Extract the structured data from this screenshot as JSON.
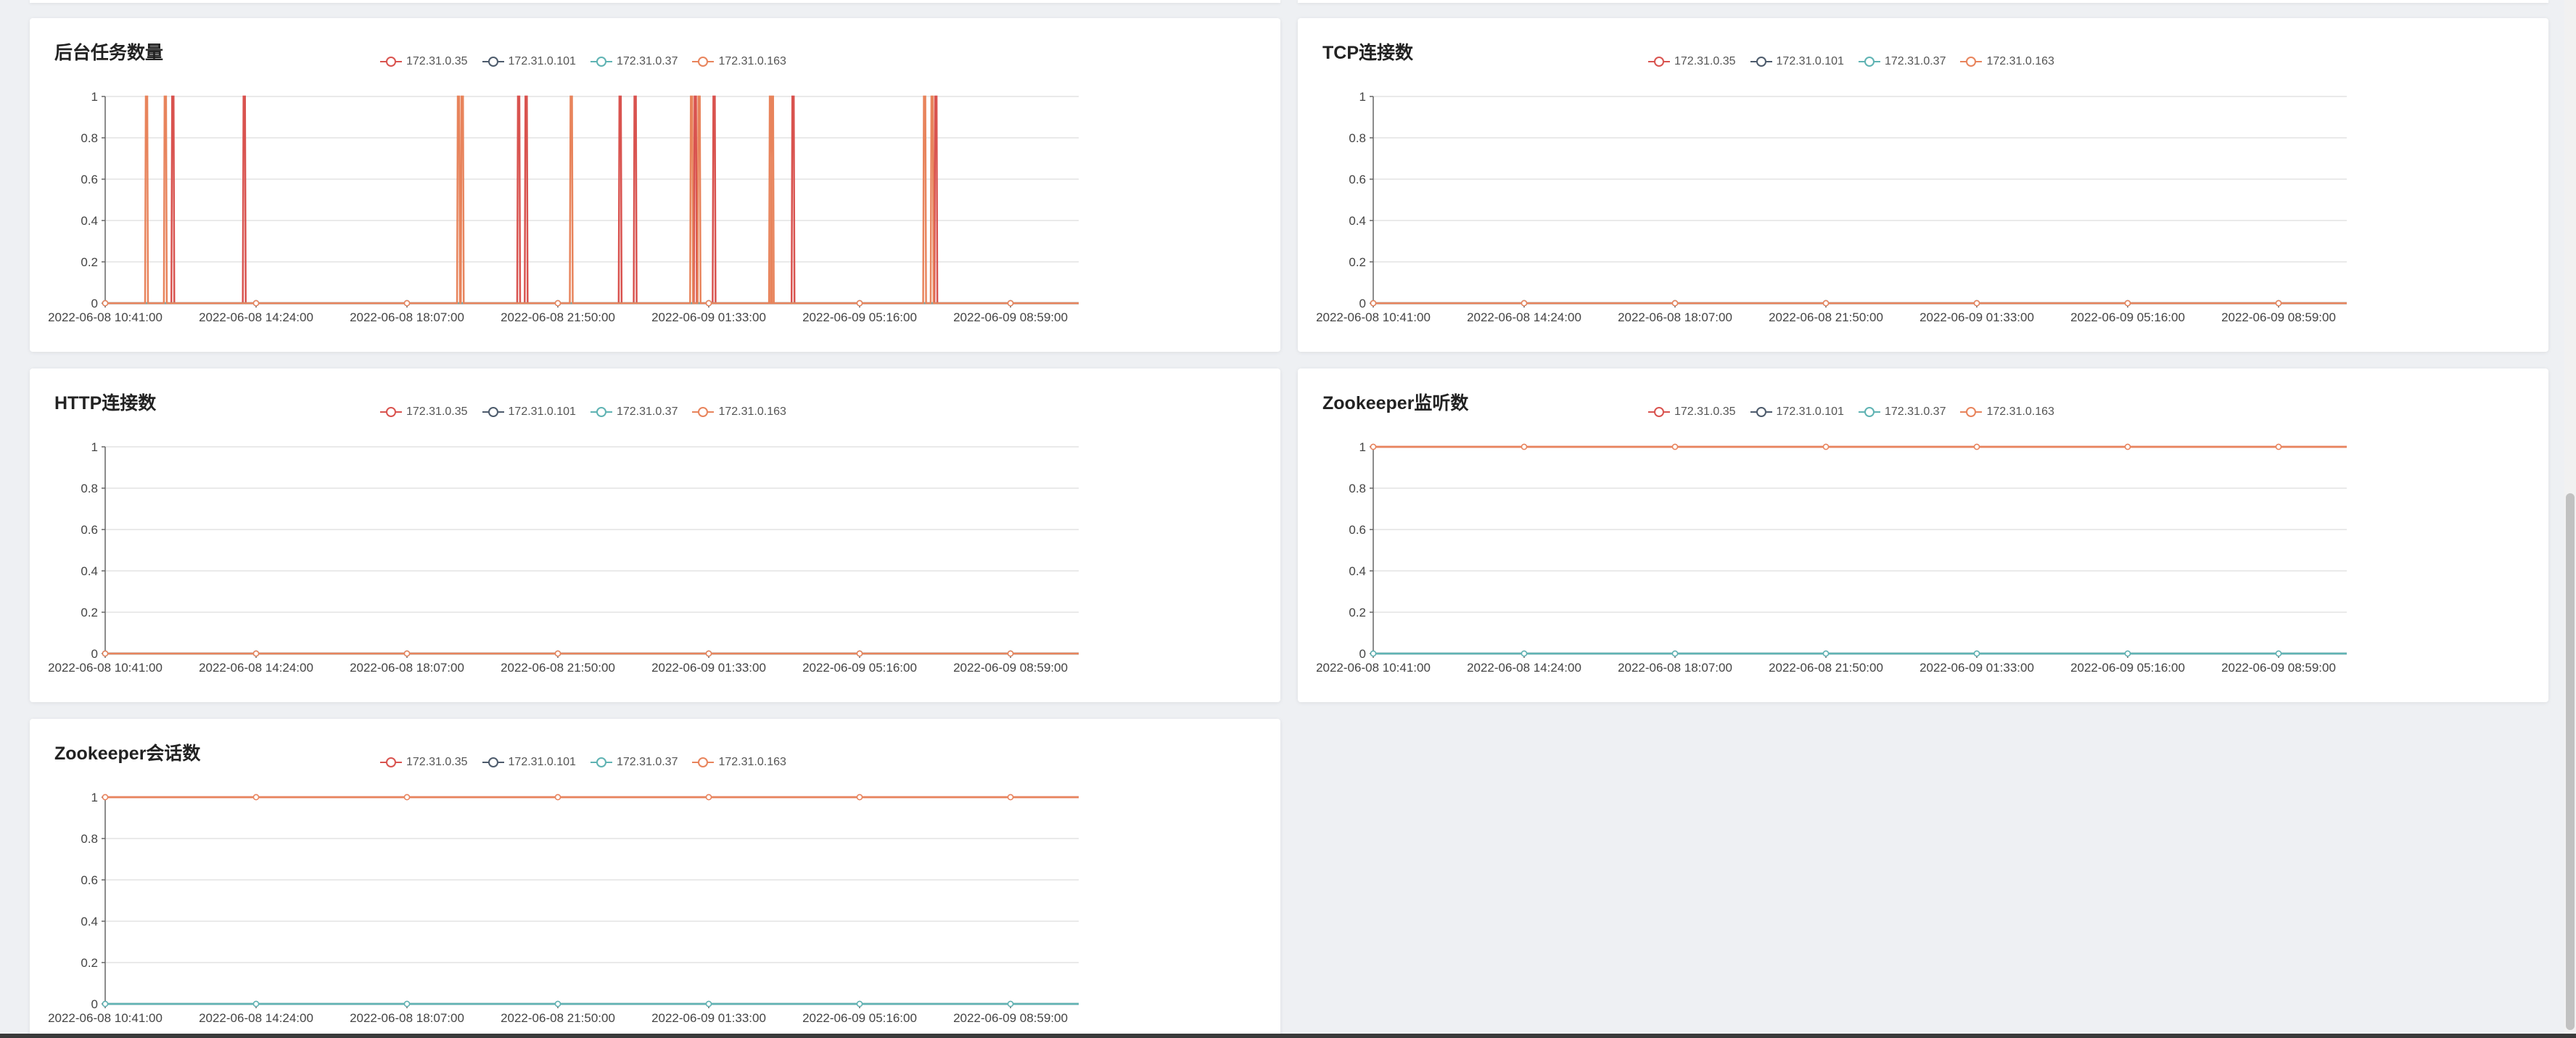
{
  "colors": {
    "172.31.0.35": "#d9534f",
    "172.31.0.101": "#4d5b6c",
    "172.31.0.37": "#5fb3b3",
    "172.31.0.163": "#e8845c",
    "grid": "#e3e3e3",
    "axis": "#666666"
  },
  "legend_labels": [
    "172.31.0.35",
    "172.31.0.101",
    "172.31.0.37",
    "172.31.0.163"
  ],
  "x_ticks": [
    "2022-06-08 10:41:00",
    "2022-06-08 14:24:00",
    "2022-06-08 18:07:00",
    "2022-06-08 21:50:00",
    "2022-06-09 01:33:00",
    "2022-06-09 05:16:00",
    "2022-06-09 08:59:00"
  ],
  "y_ticks": [
    "0",
    "0.2",
    "0.4",
    "0.6",
    "0.8",
    "1"
  ],
  "chart_data": [
    {
      "type": "line",
      "title": "后台任务数量",
      "ylim": [
        0,
        1
      ],
      "x_range_hours": [
        0,
        25.9
      ],
      "series": [
        {
          "name": "172.31.0.35",
          "values": [
            0
          ],
          "spikes": [
            1.8,
            3.7,
            11.0,
            11.2,
            13.7,
            14.1,
            15.7,
            16.2,
            18.3,
            22.1
          ]
        },
        {
          "name": "172.31.0.101",
          "values": [
            0
          ],
          "spikes": []
        },
        {
          "name": "172.31.0.37",
          "values": [
            0
          ],
          "spikes": []
        },
        {
          "name": "172.31.0.163",
          "values": [
            0
          ],
          "spikes": [
            1.1,
            1.6,
            9.4,
            9.5,
            12.4,
            15.6,
            15.8,
            17.7,
            17.75,
            21.8,
            22.0
          ]
        }
      ]
    },
    {
      "type": "line",
      "title": "TCP连接数",
      "ylim": [
        0,
        1
      ],
      "series": [
        {
          "name": "172.31.0.35",
          "value": 0
        },
        {
          "name": "172.31.0.101",
          "value": 0
        },
        {
          "name": "172.31.0.37",
          "value": 0
        },
        {
          "name": "172.31.0.163",
          "value": 0
        }
      ]
    },
    {
      "type": "line",
      "title": "HTTP连接数",
      "ylim": [
        0,
        1
      ],
      "series": [
        {
          "name": "172.31.0.35",
          "value": 0
        },
        {
          "name": "172.31.0.101",
          "value": 0
        },
        {
          "name": "172.31.0.37",
          "value": 0
        },
        {
          "name": "172.31.0.163",
          "value": 0
        }
      ]
    },
    {
      "type": "line",
      "title": "Zookeeper监听数",
      "ylim": [
        0,
        1
      ],
      "series": [
        {
          "name": "172.31.0.35",
          "value": 1
        },
        {
          "name": "172.31.0.101",
          "value": 0
        },
        {
          "name": "172.31.0.37",
          "value": 0
        },
        {
          "name": "172.31.0.163",
          "value": 1
        }
      ]
    },
    {
      "type": "line",
      "title": "Zookeeper会话数",
      "ylim": [
        0,
        1
      ],
      "series": [
        {
          "name": "172.31.0.35",
          "value": 1
        },
        {
          "name": "172.31.0.101",
          "value": 0
        },
        {
          "name": "172.31.0.37",
          "value": 0
        },
        {
          "name": "172.31.0.163",
          "value": 1
        }
      ]
    }
  ]
}
